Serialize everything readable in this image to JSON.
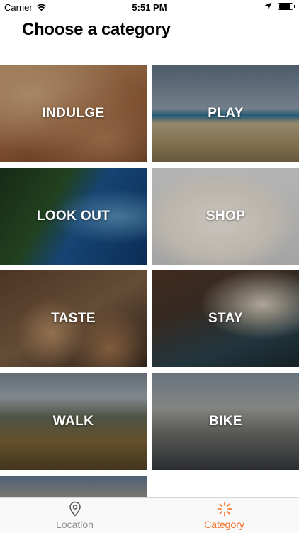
{
  "status_bar": {
    "carrier": "Carrier",
    "time": "5:51 PM",
    "battery_level": 0.8
  },
  "header": {
    "title": "Choose a category"
  },
  "categories": [
    {
      "label": "INDULGE",
      "icon": "massage-photo"
    },
    {
      "label": "PLAY",
      "icon": "beach-photo"
    },
    {
      "label": "LOOK OUT",
      "icon": "coastline-photo"
    },
    {
      "label": "SHOP",
      "icon": "wool-sheep-photo"
    },
    {
      "label": "TASTE",
      "icon": "coffee-pastry-photo"
    },
    {
      "label": "STAY",
      "icon": "hotel-bed-photo"
    },
    {
      "label": "WALK",
      "icon": "mountain-trail-photo"
    },
    {
      "label": "BIKE",
      "icon": "mountain-bike-photo"
    },
    {
      "label": "",
      "icon": "crowd-photo"
    }
  ],
  "tabbar": {
    "tabs": [
      {
        "label": "Location",
        "icon": "map-pin-icon",
        "active": false
      },
      {
        "label": "Category",
        "icon": "category-sparkle-icon",
        "active": true
      }
    ],
    "accent": "#f36d1f",
    "inactive": "#8e8e93"
  }
}
